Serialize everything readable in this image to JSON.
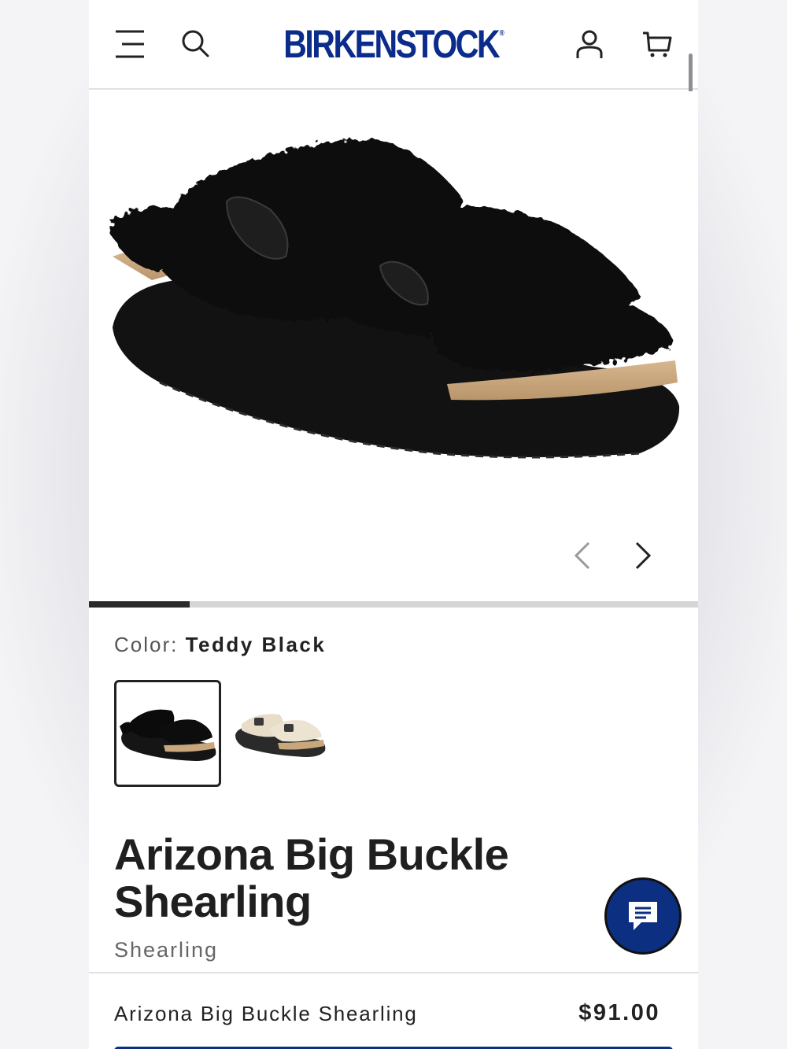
{
  "header": {
    "logo_text": "BIRKENSTOCK",
    "logo_mark": "®",
    "icons": [
      "menu-icon",
      "search-icon",
      "account-icon",
      "cart-icon"
    ],
    "brand_color": "#0c2c8c"
  },
  "gallery": {
    "image_alt": "Arizona Big Buckle Shearling in Teddy Black",
    "current_slide": 1,
    "slide_progress": 0.166,
    "prev_icon": "chevron-left-icon",
    "next_icon": "chevron-right-icon"
  },
  "color": {
    "label": "Color:",
    "value": "Teddy Black",
    "swatches": [
      {
        "name": "Teddy Black",
        "selected": true
      },
      {
        "name": "Teddy Eggshell",
        "selected": false
      }
    ]
  },
  "product": {
    "title": "Arizona Big Buckle Shearling",
    "subtitle": "Shearling"
  },
  "chat": {
    "icon": "chat-icon",
    "color": "#0c2f82"
  },
  "sticky": {
    "name": "Arizona Big Buckle Shearling",
    "price": "$91.00"
  }
}
